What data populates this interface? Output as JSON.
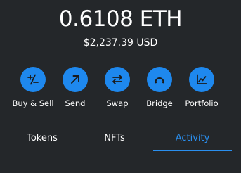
{
  "balance": {
    "crypto": "0.6108 ETH",
    "fiat": "$2,237.39 USD"
  },
  "actions": [
    {
      "label": "Buy & Sell",
      "icon": "plus-minus-icon"
    },
    {
      "label": "Send",
      "icon": "arrow-up-right-icon"
    },
    {
      "label": "Swap",
      "icon": "swap-arrows-icon"
    },
    {
      "label": "Bridge",
      "icon": "bridge-arc-icon"
    },
    {
      "label": "Portfolio",
      "icon": "chart-line-icon"
    }
  ],
  "tabs": [
    {
      "label": "Tokens",
      "active": false
    },
    {
      "label": "NFTs",
      "active": false
    },
    {
      "label": "Activity",
      "active": true
    }
  ],
  "colors": {
    "background": "#24272a",
    "accent": "#1e88ee",
    "active_tab": "#2a8fef",
    "text": "#ffffff"
  }
}
